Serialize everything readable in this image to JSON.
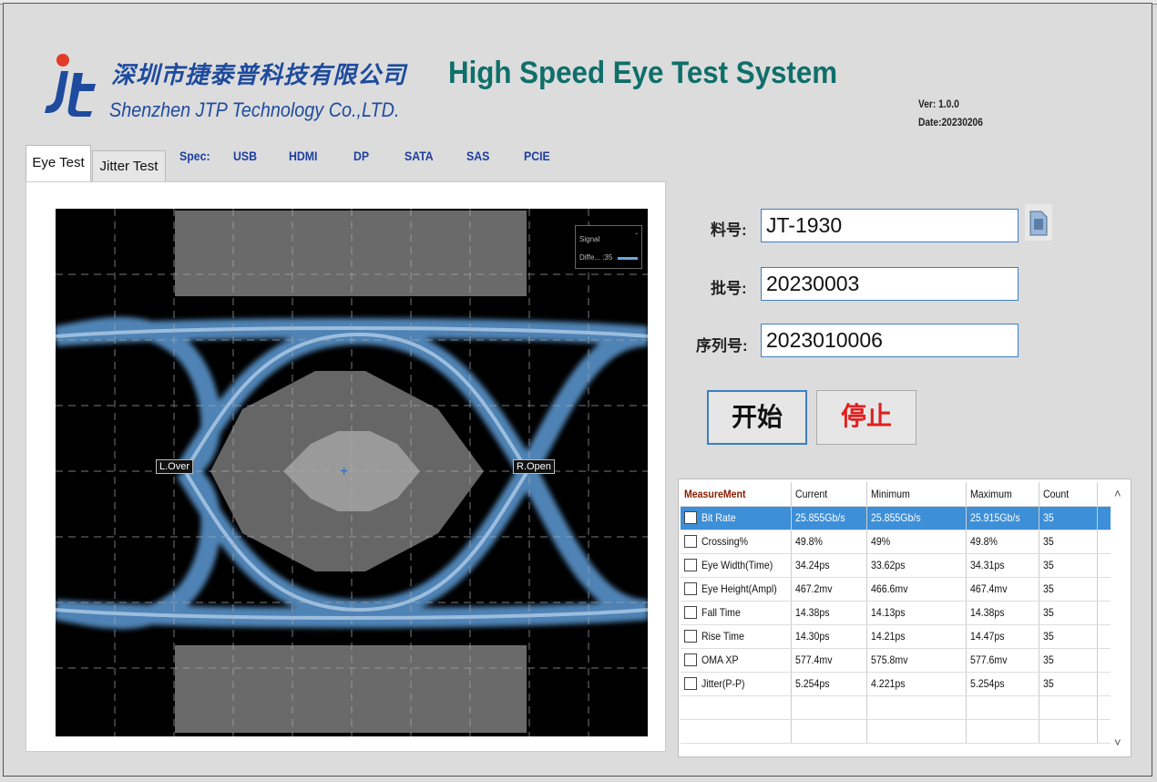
{
  "header": {
    "company_cn": "深圳市捷泰普科技有限公司",
    "company_en": "Shenzhen JTP Technology Co.,LTD.",
    "app_title": "High Speed Eye Test System",
    "version": "Ver: 1.0.0",
    "date": "Date:20230206"
  },
  "tabs": [
    {
      "label": "Eye Test",
      "active": true
    },
    {
      "label": "Jitter Test",
      "active": false
    }
  ],
  "spec": {
    "label": "Spec:",
    "options": [
      "USB",
      "HDMI",
      "DP",
      "SATA",
      "SAS",
      "PCIE"
    ]
  },
  "scope": {
    "legend_signal": "Signal",
    "legend_diff": "Diffe... :35",
    "left_marker": "L.Over",
    "right_marker": "R.Open",
    "trace_color": "#6aa8e0"
  },
  "form": {
    "part_label": "料号:",
    "part_value": "JT-1930",
    "batch_label": "批号:",
    "batch_value": "20230003",
    "serial_label": "序列号:",
    "serial_value": "2023010006"
  },
  "buttons": {
    "start": "开始",
    "stop": "停止"
  },
  "table": {
    "headers": [
      "MeasureMent",
      "Current",
      "Minimum",
      "Maximum",
      "Count"
    ],
    "rows": [
      {
        "name": "Bit Rate",
        "current": "25.855Gb/s",
        "minimum": "25.855Gb/s",
        "maximum": "25.915Gb/s",
        "count": "35",
        "selected": true
      },
      {
        "name": "Crossing%",
        "current": "49.8%",
        "minimum": "49%",
        "maximum": "49.8%",
        "count": "35"
      },
      {
        "name": "Eye Width(Time)",
        "current": "34.24ps",
        "minimum": "33.62ps",
        "maximum": "34.31ps",
        "count": "35"
      },
      {
        "name": "Eye Height(Ampl)",
        "current": "467.2mv",
        "minimum": "466.6mv",
        "maximum": "467.4mv",
        "count": "35"
      },
      {
        "name": "Fall Time",
        "current": "14.38ps",
        "minimum": "14.13ps",
        "maximum": "14.38ps",
        "count": "35"
      },
      {
        "name": "Rise Time",
        "current": "14.30ps",
        "minimum": "14.21ps",
        "maximum": "14.47ps",
        "count": "35"
      },
      {
        "name": "OMA XP",
        "current": "577.4mv",
        "minimum": "575.8mv",
        "maximum": "577.6mv",
        "count": "35"
      },
      {
        "name": "Jitter(P-P)",
        "current": "5.254ps",
        "minimum": "4.221ps",
        "maximum": "5.254ps",
        "count": "35"
      }
    ]
  },
  "colors": {
    "brand_blue": "#1e4b9e",
    "title_teal": "#0f6f6a",
    "stop_red": "#e02020",
    "selection_blue": "#3d8fd8"
  }
}
